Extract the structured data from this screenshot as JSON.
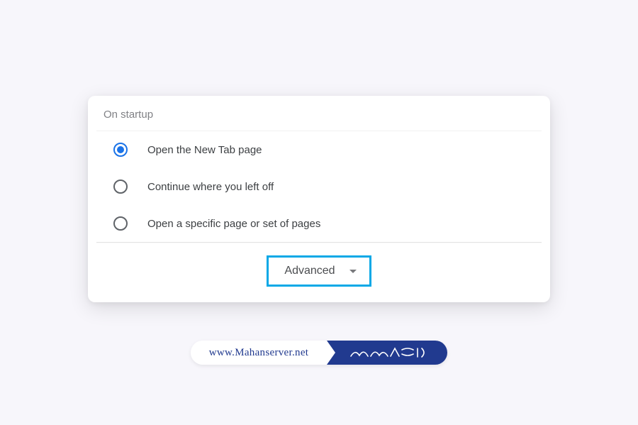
{
  "section": {
    "title": "On startup"
  },
  "options": [
    {
      "label": "Open the New Tab page",
      "selected": true
    },
    {
      "label": "Continue where you left off",
      "selected": false
    },
    {
      "label": "Open a specific page or set of pages",
      "selected": false
    }
  ],
  "advanced": {
    "label": "Advanced"
  },
  "footer": {
    "url": "www.Mahanserver.net"
  },
  "colors": {
    "accent": "#1a73e8",
    "highlight_box": "#06a8e6",
    "brand": "#213a8f"
  }
}
